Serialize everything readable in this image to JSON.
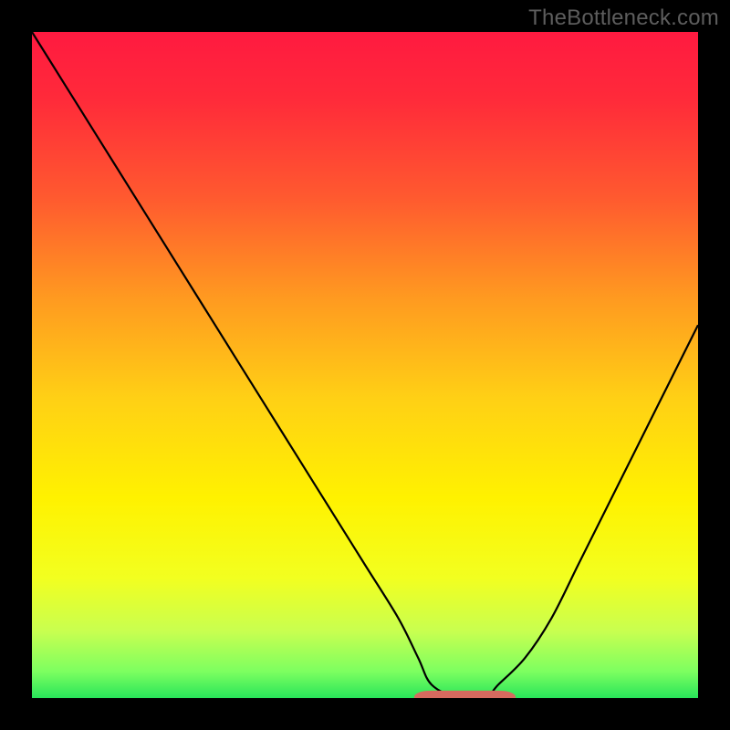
{
  "attribution": "TheBottleneck.com",
  "colors": {
    "gradient_stops": [
      {
        "offset": 0.0,
        "color": "#ff1a40"
      },
      {
        "offset": 0.1,
        "color": "#ff2a3a"
      },
      {
        "offset": 0.25,
        "color": "#ff5a2f"
      },
      {
        "offset": 0.4,
        "color": "#ff9a20"
      },
      {
        "offset": 0.55,
        "color": "#ffd015"
      },
      {
        "offset": 0.7,
        "color": "#fff200"
      },
      {
        "offset": 0.82,
        "color": "#f2ff20"
      },
      {
        "offset": 0.9,
        "color": "#c8ff50"
      },
      {
        "offset": 0.96,
        "color": "#7dff60"
      },
      {
        "offset": 1.0,
        "color": "#28e55a"
      }
    ],
    "curve": "#000000",
    "marker": "#d66a5f",
    "frame": "#000000"
  },
  "chart_data": {
    "type": "line",
    "title": "",
    "xlabel": "",
    "ylabel": "",
    "xlim": [
      0,
      100
    ],
    "ylim": [
      0,
      100
    ],
    "series": [
      {
        "name": "bottleneck-curve",
        "x": [
          0,
          5,
          10,
          15,
          20,
          25,
          30,
          35,
          40,
          45,
          50,
          55,
          58,
          60,
          64,
          68,
          70,
          74,
          78,
          82,
          86,
          90,
          94,
          98,
          100
        ],
        "values": [
          100,
          92,
          84,
          76,
          68,
          60,
          52,
          44,
          36,
          28,
          20,
          12,
          6,
          2,
          0,
          0,
          2,
          6,
          12,
          20,
          28,
          36,
          44,
          52,
          56
        ]
      }
    ],
    "flat_segment": {
      "x_start": 58,
      "x_end": 72,
      "y": 0.5
    },
    "annotations": []
  }
}
